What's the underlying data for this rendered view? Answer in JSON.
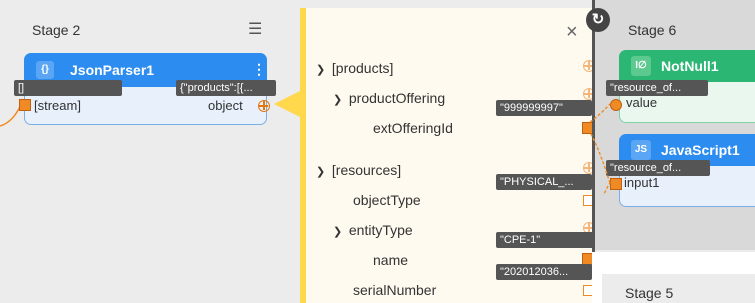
{
  "stage2": {
    "title": "Stage 2",
    "menu_icon": "hamburger-icon",
    "node": {
      "title": "JsonParser1",
      "icon": "{}",
      "input_port": "[stream]",
      "output_port": "object",
      "input_tooltip": "[]",
      "output_tooltip": "{\"products\":[{..."
    }
  },
  "schema_panel": {
    "close_icon": "×",
    "rows": [
      {
        "label": "[products]",
        "expanded": true
      },
      {
        "label": "productOffering",
        "expanded": true
      },
      {
        "label": "extOfferingId"
      },
      {
        "label": "[resources]",
        "expanded": true
      },
      {
        "label": "objectType"
      },
      {
        "label": "entityType",
        "expanded": true
      },
      {
        "label": "name"
      },
      {
        "label": "serialNumber"
      }
    ],
    "value_tooltips": {
      "extOfferingId": "\"999999997\"",
      "objectType": "\"PHYSICAL_...",
      "name": "\"CPE-1\"",
      "serialNumber": "\"202012036..."
    }
  },
  "stage6": {
    "title": "Stage 6",
    "badge_icon": "refresh-icon",
    "notnull": {
      "title": "NotNull1",
      "icon": "I∅",
      "port": "value",
      "tooltip": "\"resource_of..."
    },
    "javascript": {
      "title": "JavaScript1",
      "icon": "JS",
      "port": "input1",
      "tooltip": "\"resource_of..."
    }
  },
  "stage5": {
    "title": "Stage 5"
  },
  "colors": {
    "accent_blue": "#2d8cf0",
    "accent_green": "#2bb673",
    "port_orange": "#f08a24",
    "panel_border": "#ffd84d"
  }
}
